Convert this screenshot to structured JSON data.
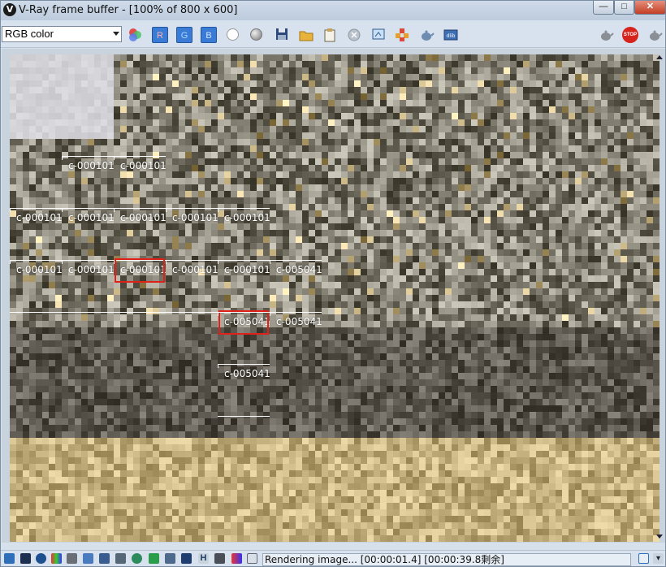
{
  "window": {
    "title": "V-Ray frame buffer - [100% of 800 x 600]",
    "app_icon": "vray-logo-icon",
    "minimize_label": "—",
    "maximize_label": "□",
    "close_label": "✕"
  },
  "toolbar": {
    "channel_select_value": "RGB color",
    "red_label": "R",
    "green_label": "G",
    "blue_label": "B",
    "stop_label": "STOP",
    "icons": [
      "color-mix-icon",
      "red-channel-button",
      "green-channel-button",
      "blue-channel-button",
      "white-dot-icon",
      "gray-dot-icon",
      "save-icon",
      "open-folder-icon",
      "clipboard-icon",
      "clear-icon",
      "region-icon",
      "track-mouse-icon",
      "teapot-icon",
      "lut-icon",
      "teapot-icon",
      "stop-icon",
      "teapot-icon"
    ]
  },
  "render": {
    "bucket_labels": [
      "c-000101",
      "c-000101",
      "c-000101",
      "c-000101",
      "c-000101",
      "c-000101",
      "c-000101",
      "c-000101",
      "c-000101",
      "c-000101",
      "c-000101",
      "c-000101",
      "c-005041",
      "c-005041",
      "c-005041",
      "c-005041"
    ],
    "highlight_color": "#e0211a"
  },
  "statusbar": {
    "status_text": "Rendering image... [00:00:01.4] [00:00:39.8剩余]"
  }
}
